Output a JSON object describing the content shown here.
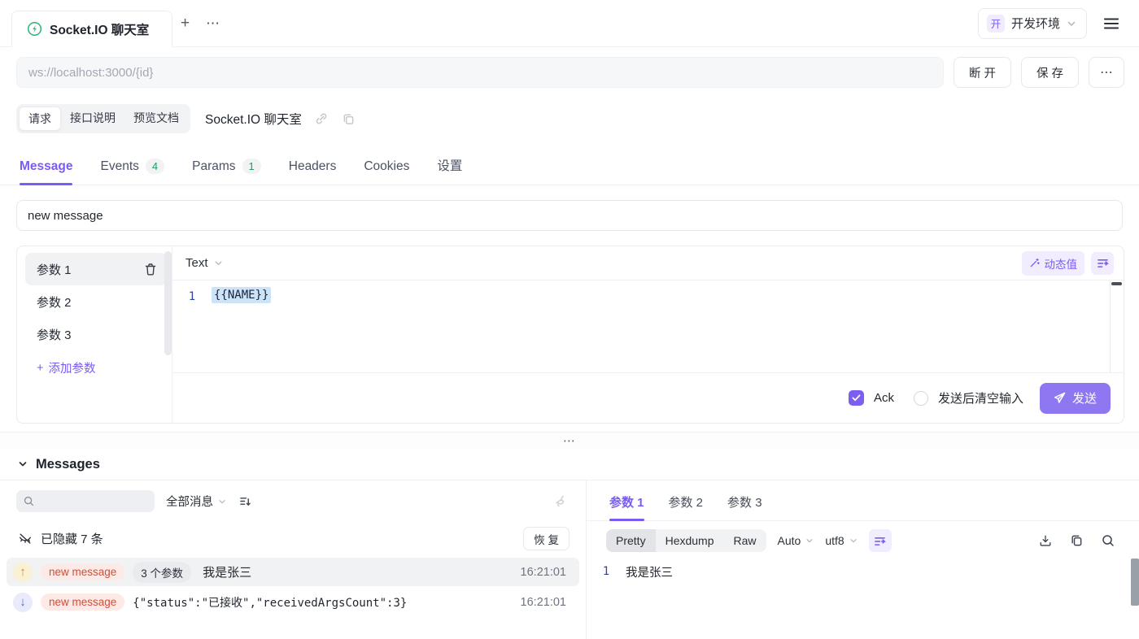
{
  "icons": {
    "plus": "+",
    "more": "⋯",
    "splitter": "⋯",
    "arrow_up": "↑",
    "arrow_down": "↓"
  },
  "colors": {
    "accent": "#7b5bf2",
    "send_button": "#8e77f0",
    "green": "#1ba05f",
    "socketio_green": "#2bb673",
    "event_tag_bg": "#fdeae6",
    "event_tag_text": "#cf4f39",
    "up_arrow": "#cf8c1e",
    "down_arrow": "#5b63d3",
    "code_highlight": "#cde3f6"
  },
  "window": {
    "tab_title": "Socket.IO 聊天室",
    "env_badge": "开",
    "env_name": "开发环境"
  },
  "url_bar": {
    "placeholder": "ws://localhost:3000/{id}",
    "disconnect_label": "断 开",
    "save_label": "保 存",
    "more_label": "⋯"
  },
  "doc_tabs": {
    "items": [
      {
        "label": "请求"
      },
      {
        "label": "接口说明"
      },
      {
        "label": "预览文档"
      }
    ],
    "title": "Socket.IO 聊天室"
  },
  "main_tabs": {
    "message": "Message",
    "events": "Events",
    "events_count": "4",
    "params": "Params",
    "params_count": "1",
    "headers": "Headers",
    "cookies": "Cookies",
    "settings": "设置"
  },
  "composer": {
    "event_name": "new message",
    "params": [
      {
        "label": "参数 1"
      },
      {
        "label": "参数 2"
      },
      {
        "label": "参数 3"
      }
    ],
    "add_param_label": "添加参数",
    "type_label": "Text",
    "dynamic_value_label": "动态值",
    "code_line_no": "1",
    "code": "{{NAME}}",
    "ack_label": "Ack",
    "clear_after_send_label": "发送后清空输入",
    "send_label": "发送"
  },
  "messages": {
    "title": "Messages",
    "filter_all_label": "全部消息",
    "hidden_info": "已隐藏 7 条",
    "restore_label": "恢 复",
    "rows": [
      {
        "direction": "up",
        "event": "new message",
        "args_count": "3 个参数",
        "content": "我是张三",
        "time": "16:21:01"
      },
      {
        "direction": "down",
        "event": "new message",
        "content": "{\"status\":\"已接收\",\"receivedArgsCount\":3}",
        "time": "16:21:01"
      }
    ]
  },
  "inspector": {
    "tabs": [
      {
        "label": "参数 1"
      },
      {
        "label": "参数 2"
      },
      {
        "label": "参数 3"
      }
    ],
    "view_modes": [
      {
        "label": "Pretty"
      },
      {
        "label": "Hexdump"
      },
      {
        "label": "Raw"
      }
    ],
    "decode_label": "Auto",
    "charset_label": "utf8",
    "line_no": "1",
    "content": "我是张三"
  }
}
